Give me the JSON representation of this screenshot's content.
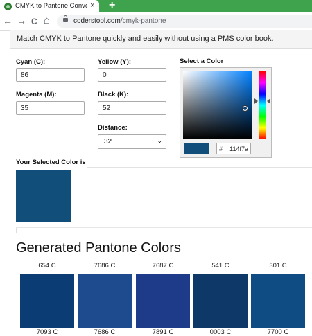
{
  "browser": {
    "tab_title": "CMYK to Pantone Converter | Co",
    "tab_close": "×",
    "new_tab": "+",
    "back": "←",
    "forward": "→",
    "reload": "C",
    "home": "⌂",
    "url_host": "coderstool.com",
    "url_path": "/cmyk-pantone"
  },
  "banner": {
    "text": "Match CMYK to Pantone quickly and easily without using a PMS color book."
  },
  "form": {
    "cyan_label": "Cyan (C):",
    "cyan_value": "86",
    "yellow_label": "Yellow (Y):",
    "yellow_value": "0",
    "magenta_label": "Magenta (M):",
    "magenta_value": "35",
    "black_label": "Black (K):",
    "black_value": "52",
    "distance_label": "Distance:",
    "distance_value": "32"
  },
  "picker": {
    "title": "Select a Color",
    "hash": "#",
    "hex": "114f7a",
    "swatch_color": "#114f7a"
  },
  "selected": {
    "label": "Your Selected Color is",
    "color": "#114f7a"
  },
  "generated": {
    "heading": "Generated Pantone Colors",
    "items": [
      {
        "name": "654 C",
        "color": "#0b3c73",
        "code": "7093 C"
      },
      {
        "name": "7686 C",
        "color": "#1e4a8e",
        "code": "7686 C"
      },
      {
        "name": "7687 C",
        "color": "#1d3b88",
        "code": "7891 C"
      },
      {
        "name": "541 C",
        "color": "#0e3868",
        "code": "0003 C"
      },
      {
        "name": "301 C",
        "color": "#0f4c84",
        "code": "7700 C"
      }
    ]
  }
}
